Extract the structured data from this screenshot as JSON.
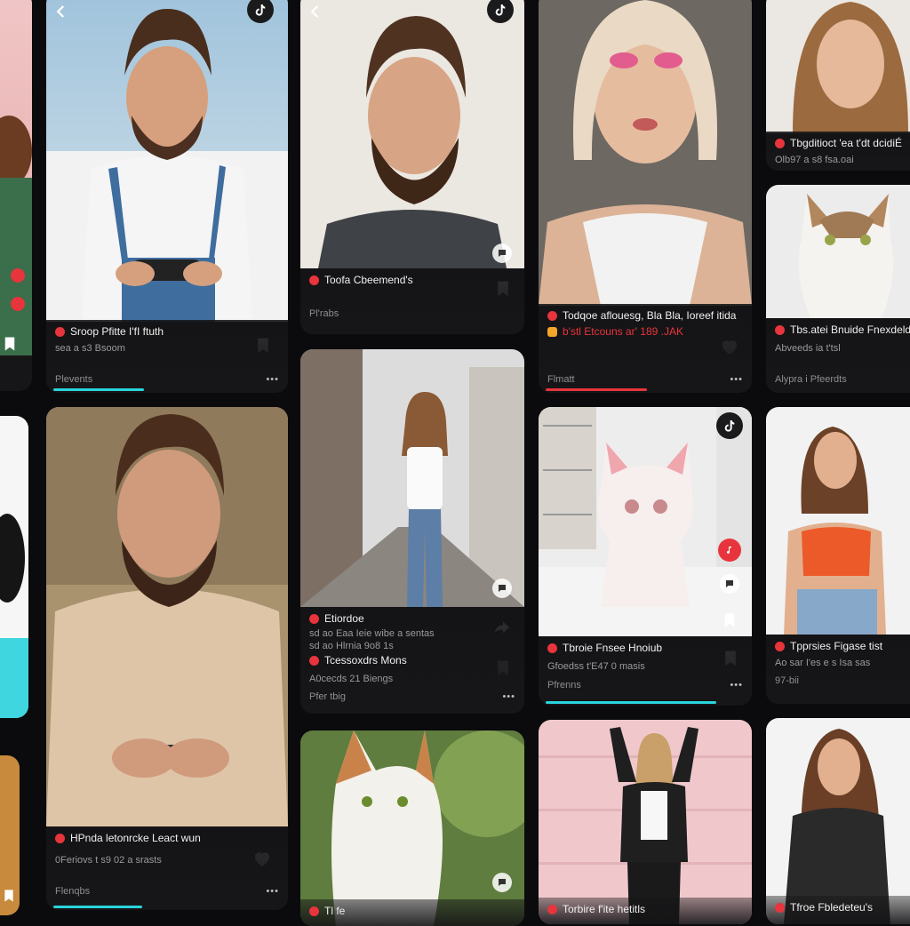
{
  "cards": [
    {
      "id": "c1",
      "title": "Sroop Pfitte I'fI ftuth",
      "meta": "sea a s3 Bsoom",
      "foot": "Plevents",
      "bar": "#2ad4dc"
    },
    {
      "id": "c2",
      "title": "Toofa Cbeemend's",
      "meta": "",
      "foot": "Pl'rabs",
      "bar": ""
    },
    {
      "id": "c3",
      "title": "Todqoe aflouesg, Bla Bla, Ioreef itida",
      "meta": "b'stl Etcouns ar' 189 .JAK",
      "foot": "Flmatt",
      "bar": "#e8343c"
    },
    {
      "id": "c4",
      "title": "Tbgditioct 'ea t'dt dcidiÉ",
      "meta": "Olb97 a s8 fsa.oai",
      "foot": "",
      "bar": ""
    },
    {
      "id": "c5",
      "title": "Tbs.atei Bnuide Fnexdeld;",
      "meta": "Abveeds ia t'tsl",
      "foot": "Alypra i Pfeerdts",
      "bar": ""
    },
    {
      "id": "c6",
      "title": "HPnda letonrcke Leact wun",
      "meta": "0Feriovs t s9 02 a srasts",
      "foot": "Flenqbs",
      "bar": "#2ad4dc"
    },
    {
      "id": "c7",
      "title": "Etiordoe",
      "meta": "sd ao Eaa Ieie wibe a sentas",
      "meta2": "sd ao Hlrnia 9o8 1s",
      "title2": "Tcessoxdrs Mons",
      "meta3": "A0cecds 21 Biengs",
      "foot": "Pfer tbig",
      "bar": ""
    },
    {
      "id": "c8",
      "title": "Tbroie Fnsee Hnoiub",
      "meta": "Gfoedss t'E47 0 masis",
      "foot": "Pfrenns",
      "bar": "#2ad4dc"
    },
    {
      "id": "c9",
      "title": "Tpprsies Figase tist",
      "meta": "Ao sar I'es e s Isa sas",
      "foot": "97-bii",
      "bar": ""
    },
    {
      "id": "c10",
      "title": "Torbire f'ite hetitls",
      "meta": "",
      "foot": "",
      "bar": ""
    },
    {
      "id": "c11",
      "title": "Tfroe Fbledeteu's",
      "meta": "",
      "foot": "",
      "bar": ""
    },
    {
      "id": "c12",
      "title": "Tl fe",
      "meta": "",
      "foot": "",
      "bar": ""
    }
  ],
  "icons": {
    "brand": "tiktok-icon",
    "like": "heart-icon",
    "save": "bookmark-icon",
    "share": "share-arrow-icon",
    "comment": "comment-icon",
    "back": "chevron-left-icon",
    "more": "more-dots-icon"
  },
  "dots": "•••"
}
